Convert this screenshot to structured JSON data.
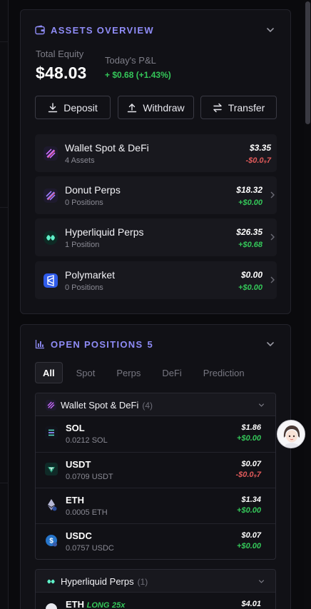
{
  "assets_overview": {
    "title": "ASSETS OVERVIEW",
    "total_equity_label": "Total Equity",
    "total_equity_value": "$48.03",
    "pnl_label": "Today's P&L",
    "pnl_value": "+ $0.68 (+1.43%)",
    "buttons": {
      "deposit": "Deposit",
      "withdraw": "Withdraw",
      "transfer": "Transfer"
    },
    "accounts": [
      {
        "name": "Wallet Spot & DeFi",
        "sub": "4 Assets",
        "value": "$3.35",
        "change": "-$0.0₉7",
        "change_color": "#e05a5a"
      },
      {
        "name": "Donut Perps",
        "sub": "0 Positions",
        "value": "$18.32",
        "change": "+$0.00",
        "change_color": "#34c759"
      },
      {
        "name": "Hyperliquid Perps",
        "sub": "1 Position",
        "value": "$26.35",
        "change": "+$0.68",
        "change_color": "#34c759"
      },
      {
        "name": "Polymarket",
        "sub": "0 Positions",
        "value": "$0.00",
        "change": "+$0.00",
        "change_color": "#34c759"
      }
    ]
  },
  "open_positions": {
    "title": "OPEN POSITIONS",
    "count": "5",
    "tabs": [
      "All",
      "Spot",
      "Perps",
      "DeFi",
      "Prediction"
    ],
    "active_tab": "All",
    "groups": [
      {
        "title": "Wallet Spot & DeFi",
        "count": "(4)",
        "rows": [
          {
            "name": "SOL",
            "sub": "0.0212 SOL",
            "value": "$1.86",
            "change": "+$0.00",
            "icon": "sol-icon"
          },
          {
            "name": "USDT",
            "sub": "0.0709 USDT",
            "value": "$0.07",
            "change": "-$0.0₉7",
            "icon": "usdt-icon"
          },
          {
            "name": "ETH",
            "sub": "0.0005 ETH",
            "value": "$1.34",
            "change": "+$0.00",
            "icon": "eth-icon"
          },
          {
            "name": "USDC",
            "sub": "0.0757 USDC",
            "value": "$0.07",
            "change": "+$0.00",
            "icon": "usdc-icon"
          }
        ]
      },
      {
        "title": "Hyperliquid Perps",
        "count": "(1)",
        "rows": [
          {
            "name": "ETH",
            "side": "LONG",
            "leverage": "25x",
            "value": "$4.01"
          }
        ]
      }
    ]
  },
  "colors": {
    "accent": "#8f8cf7",
    "positive": "#34c759",
    "negative": "#e05a5a",
    "panel": "#111116"
  }
}
